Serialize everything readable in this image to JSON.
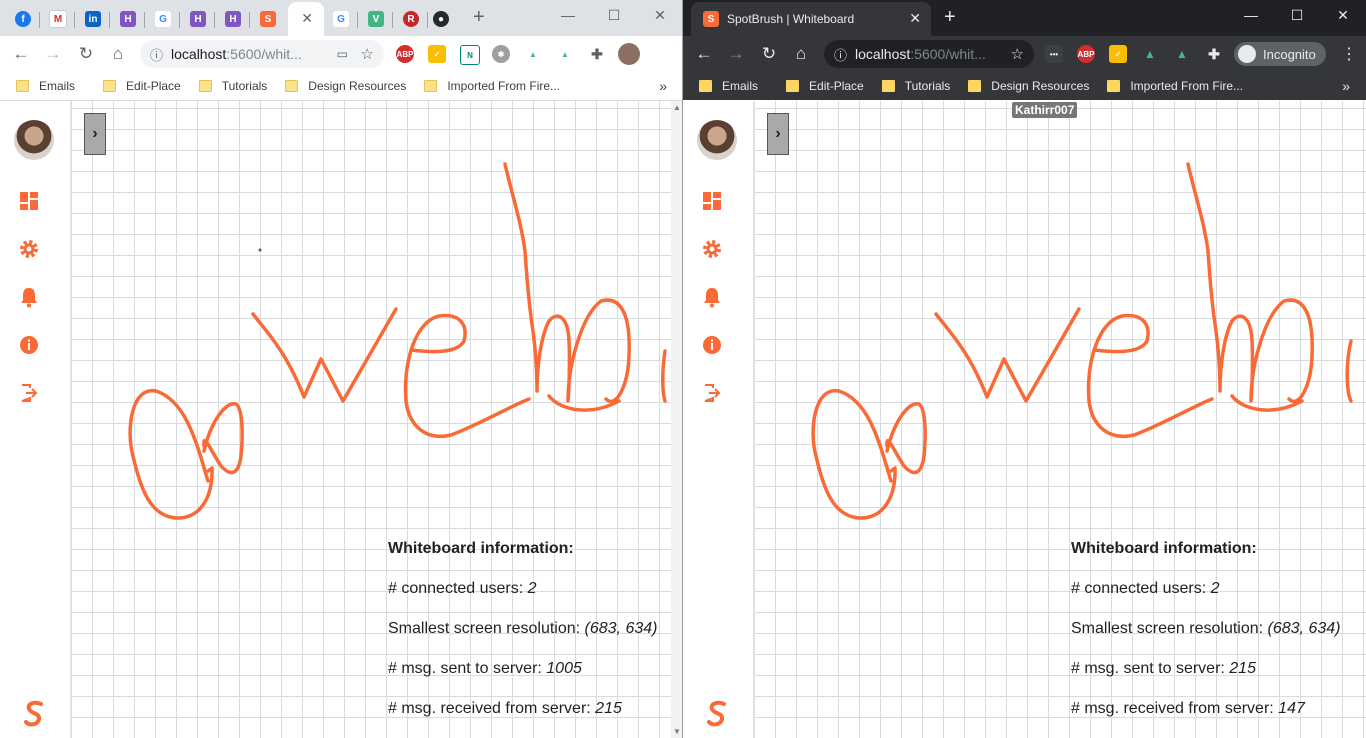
{
  "colors": {
    "brand": "#f96a36",
    "stroke": "#f96a36"
  },
  "left_window": {
    "tab_favicons": [
      "facebook-icon",
      "gmail-icon",
      "linkedin-icon",
      "h-app-icon",
      "google-icon",
      "h-app-icon",
      "h-app-icon",
      "spotbrush-icon"
    ],
    "tab_favicons_after": [
      "google-icon",
      "vue-icon",
      "react-icon",
      "github-icon"
    ],
    "url_host": "localhost",
    "url_rest": ":5600/whit...",
    "bookmarks": [
      "Emails",
      "Edit-Place",
      "Tutorials",
      "Design Resources",
      "Imported From Fire..."
    ],
    "bookmarks_more": "»"
  },
  "right_window": {
    "tab_title": "SpotBrush | Whiteboard",
    "url_host": "localhost",
    "url_rest": ":5600/whit...",
    "incognito_label": "Incognito",
    "bookmarks": [
      "Emails",
      "Edit-Place",
      "Tutorials",
      "Design Resources",
      "Imported From Fire..."
    ],
    "bookmarks_more": "»",
    "cursor_user": "Kathirr007"
  },
  "whiteboard_left": {
    "info_title": "Whiteboard information:",
    "connected_users_label": "# connected users: ",
    "connected_users": "2",
    "resolution_label": "Smallest screen resolution: ",
    "resolution": "(683, 634)",
    "sent_label": "# msg. sent to server: ",
    "sent": "1005",
    "received_label": "# msg. received from server: ",
    "received": "215"
  },
  "whiteboard_right": {
    "info_title": "Whiteboard information:",
    "connected_users_label": "# connected users: ",
    "connected_users": "2",
    "resolution_label": "Smallest screen resolution: ",
    "resolution": "(683, 634)",
    "sent_label": "# msg. sent to server: ",
    "sent": "215",
    "received_label": "# msg. received from server: ",
    "received": "147"
  },
  "sidebar_icons": [
    "dashboard-icon",
    "settings-icon",
    "notifications-icon",
    "info-icon",
    "logout-icon"
  ],
  "toggle_glyph": "›"
}
